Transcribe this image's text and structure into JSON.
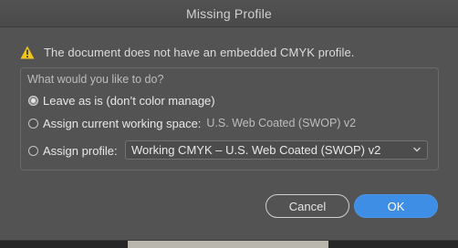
{
  "dialog": {
    "title": "Missing Profile"
  },
  "warning": {
    "icon": "warning-triangle-icon",
    "icon_color": "#f0c419",
    "message": "The document does not have an embedded CMYK profile."
  },
  "options": {
    "prompt": "What would you like to do?",
    "leave_as_is_label": "Leave as is (don’t color manage)",
    "leave_as_is_selected": true,
    "assign_working_label": "Assign current working space:",
    "assign_working_value": "U.S. Web Coated (SWOP) v2",
    "assign_working_selected": false,
    "assign_profile_label": "Assign profile:",
    "assign_profile_selected": false,
    "profile_select_value": "Working CMYK – U.S. Web Coated (SWOP) v2"
  },
  "buttons": {
    "cancel_label": "Cancel",
    "ok_label": "OK",
    "ok_color": "#3f8ee6"
  }
}
